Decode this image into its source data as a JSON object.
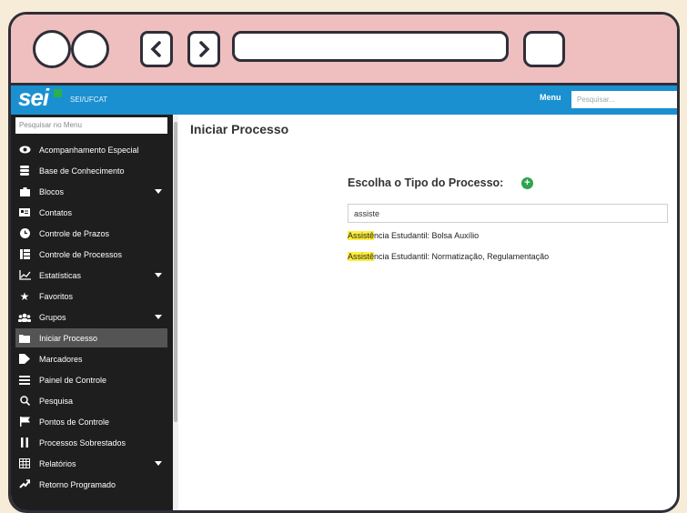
{
  "app": {
    "logo": "sei",
    "org": "SEI/UFCAT",
    "menu_label": "Menu",
    "search_placeholder": "Pesquisar..."
  },
  "browser": {
    "url": ""
  },
  "sidebar": {
    "search_placeholder": "Pesquisar no Menu",
    "items": [
      {
        "label": "Acompanhamento Especial",
        "icon": "eye-icon",
        "expandable": false
      },
      {
        "label": "Base de Conhecimento",
        "icon": "database-icon",
        "expandable": false
      },
      {
        "label": "Blocos",
        "icon": "briefcase-icon",
        "expandable": true
      },
      {
        "label": "Contatos",
        "icon": "contact-card-icon",
        "expandable": false
      },
      {
        "label": "Controle de Prazos",
        "icon": "clock-icon",
        "expandable": false
      },
      {
        "label": "Controle de Processos",
        "icon": "list-icon",
        "expandable": false
      },
      {
        "label": "Estatísticas",
        "icon": "chart-icon",
        "expandable": true
      },
      {
        "label": "Favoritos",
        "icon": "star-icon",
        "expandable": false
      },
      {
        "label": "Grupos",
        "icon": "group-icon",
        "expandable": true
      },
      {
        "label": "Iniciar Processo",
        "icon": "folder-icon",
        "expandable": false,
        "active": true
      },
      {
        "label": "Marcadores",
        "icon": "tag-icon",
        "expandable": false
      },
      {
        "label": "Painel de Controle",
        "icon": "panel-icon",
        "expandable": false
      },
      {
        "label": "Pesquisa",
        "icon": "search-icon",
        "expandable": false
      },
      {
        "label": "Pontos de Controle",
        "icon": "flag-icon",
        "expandable": false
      },
      {
        "label": "Processos Sobrestados",
        "icon": "pause-icon",
        "expandable": false
      },
      {
        "label": "Relatórios",
        "icon": "table-icon",
        "expandable": true
      },
      {
        "label": "Retorno Programado",
        "icon": "return-icon",
        "expandable": false
      }
    ]
  },
  "main": {
    "page_title": "Iniciar Processo",
    "choose_title": "Escolha o Tipo do Processo:",
    "filter_value": "assiste",
    "results": [
      {
        "highlight": "Assistê",
        "rest": "ncia Estudantil: Bolsa Auxílio"
      },
      {
        "highlight": "Assistê",
        "rest": "ncia Estudantil: Normatização, Regulamentação"
      }
    ]
  },
  "colors": {
    "header_blue": "#1a90d1",
    "sidebar_bg": "#1e1e1e",
    "active_item": "#545454",
    "highlight": "#ffef3a",
    "add_green": "#2da44e"
  }
}
